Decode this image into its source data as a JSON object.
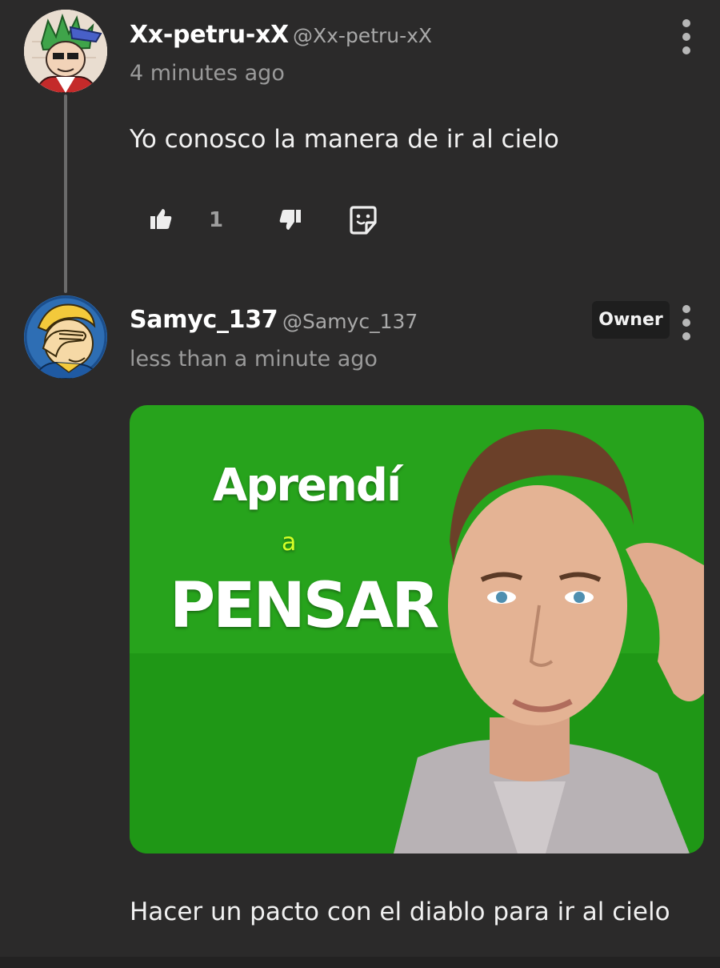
{
  "comments": [
    {
      "username": "Xx-petru-xX",
      "handle": "@Xx-petru-xX",
      "timestamp": "4 minutes ago",
      "text": "Yo conosco la manera de ir al cielo",
      "like_count": "1",
      "avatar_icon": "cartoon-avatar-green-hair"
    },
    {
      "username": "Samyc_137",
      "handle": "@Samyc_137",
      "timestamp": "less than a minute ago",
      "badge": "Owner",
      "text": "Hacer un pacto con el diablo para ir al cielo",
      "avatar_icon": "vault-boy-facepalm",
      "image": {
        "line1": "Aprendí",
        "line2": "a",
        "line3": "PENSAR"
      }
    }
  ],
  "colors": {
    "background": "#2b2a2a",
    "image_green": "#22a31a",
    "badge_bg": "#1e1e1e"
  }
}
